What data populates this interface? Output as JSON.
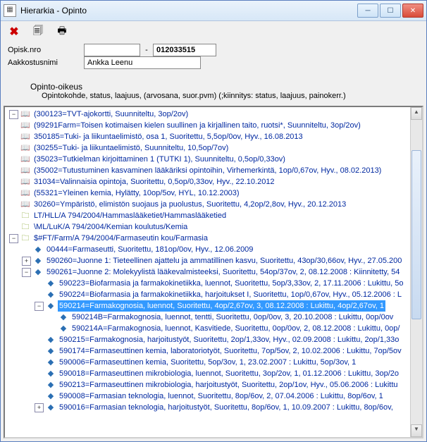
{
  "window": {
    "title": "Hierarkia - Opinto"
  },
  "form": {
    "label_opisknro": "Opisk.nro",
    "label_aakostusnimi": "Aakkostusnimi",
    "blank_field": "",
    "dash": "-",
    "student_id": "012033515",
    "student_name": "Ankka Leenu",
    "heading": "Opinto-oikeus",
    "subdesc": "Opintokohde, status, laajuus, (arvosana, suor.pvm) (;kiinnitys: status, laajuus, painokerr.)"
  },
  "tree": [
    {
      "depth": 0,
      "toggle": "-",
      "icon": "book",
      "text": "(300123=TVT-ajokortti, Suunniteltu, 3op/2ov)"
    },
    {
      "depth": 0,
      "toggle": "",
      "icon": "book",
      "text": "(99291Farm=Toisen kotimaisen kielen suullinen ja kirjallinen taito, ruotsi*, Suunniteltu, 3op/2ov)"
    },
    {
      "depth": 0,
      "toggle": "",
      "icon": "book",
      "text": "350185=Tuki- ja liikuntaelimistö, osa 1, Suoritettu, 5,5op/0ov, Hyv., 16.08.2013"
    },
    {
      "depth": 0,
      "toggle": "",
      "icon": "book",
      "text": "(30255=Tuki- ja liikuntaelimistö, Suunniteltu, 10,5op/7ov)"
    },
    {
      "depth": 0,
      "toggle": "",
      "icon": "book",
      "text": "(35023=Tutkielman kirjoittaminen 1 (TUTKI 1), Suunniteltu, 0,5op/0,33ov)"
    },
    {
      "depth": 0,
      "toggle": "",
      "icon": "book",
      "text": "(35002=Tutustuminen kasvaminen lääkäriksi opintoihin, Virhemerkintä, 1op/0,67ov, Hyv., 08.02.2013)"
    },
    {
      "depth": 0,
      "toggle": "",
      "icon": "book",
      "text": "31034=Valinnaisia opintoja, Suoritettu, 0,5op/0,33ov, Hyv., 22.10.2012"
    },
    {
      "depth": 0,
      "toggle": "",
      "icon": "book",
      "text": "(55321=Yleinen kemia, Hylätty, 10op/5ov, HYL, 10.12.2003)"
    },
    {
      "depth": 0,
      "toggle": "",
      "icon": "book",
      "text": "30260=Ympäristö, elimistön suojaus ja puolustus, Suoritettu, 4,2op/2,8ov, Hyv., 20.12.2013"
    },
    {
      "depth": 0,
      "toggle": "",
      "icon": "folder",
      "text": "LT/HLL/A 794/2004/Hammaslääketiet/Hammaslääketied"
    },
    {
      "depth": 0,
      "toggle": "",
      "icon": "folder",
      "text": "\\ML/LuK/A 794/2004/Kemian koulutus/Kemia"
    },
    {
      "depth": 0,
      "toggle": "-",
      "icon": "folder",
      "text": "$#FT/Farm/A 794/2004/Farmaseutin kou/Farmasia"
    },
    {
      "depth": 1,
      "toggle": "",
      "icon": "cube",
      "text": "00444=Farmaseutti, Suoritettu, 181op/0ov, Hyv., 12.06.2009"
    },
    {
      "depth": 1,
      "toggle": "+",
      "icon": "cube",
      "text": "590260=Juonne 1: Tieteellinen ajattelu ja ammatillinen kasvu, Suoritettu, 43op/30,66ov, Hyv., 27.05.200"
    },
    {
      "depth": 1,
      "toggle": "-",
      "icon": "cube",
      "text": "590261=Juonne 2: Molekyylistä lääkevalmisteeksi, Suoritettu, 54op/37ov, 2, 08.12.2008 : Kiinnitetty, 54"
    },
    {
      "depth": 2,
      "toggle": "",
      "icon": "cube",
      "text": "590223=Biofarmasia ja farmakokinetiikka, luennot, Suoritettu, 5op/3,33ov, 2, 17.11.2006 : Lukittu, 5o"
    },
    {
      "depth": 2,
      "toggle": "",
      "icon": "cube",
      "text": "590224=Biofarmasia ja farmakokinetiikka, harjoitukset I, Suoritettu, 1op/0,67ov, Hyv., 05.12.2006 : L"
    },
    {
      "depth": 2,
      "toggle": "-",
      "icon": "cube",
      "text": "590214=Farmakognosia, luennot, Suoritettu, 4op/2,67ov, 3, 08.12.2008 : Lukittu, 4op/2,67ov, 1",
      "selected": true
    },
    {
      "depth": 3,
      "toggle": "",
      "icon": "cube",
      "text": "590214B=Farmakognosia, luennot, tentti, Suoritettu, 0op/0ov, 3, 20.10.2008 : Lukittu, 0op/0ov"
    },
    {
      "depth": 3,
      "toggle": "",
      "icon": "cube",
      "text": "590214A=Farmakognosia, luennot, Kasvitiede, Suoritettu, 0op/0ov, 2, 08.12.2008 : Lukittu, 0op/"
    },
    {
      "depth": 2,
      "toggle": "",
      "icon": "cube",
      "text": "590215=Farmakognosia, harjoitustyöt, Suoritettu, 2op/1,33ov, Hyv., 02.09.2008 : Lukittu, 2op/1,33o"
    },
    {
      "depth": 2,
      "toggle": "",
      "icon": "cube",
      "text": "590174=Farmaseuttinen kemia, laboratoriotyöt, Suoritettu, 7op/5ov, 2, 10.02.2006 : Lukittu, 7op/5ov"
    },
    {
      "depth": 2,
      "toggle": "",
      "icon": "cube",
      "text": "590006=Farmaseuttinen kemia, Suoritettu, 5op/3ov, 1, 23.02.2007 : Lukittu, 5op/3ov, 1"
    },
    {
      "depth": 2,
      "toggle": "",
      "icon": "cube",
      "text": "590018=Farmaseuttinen mikrobiologia, luennot, Suoritettu, 3op/2ov, 1, 01.12.2006 : Lukittu, 3op/2o"
    },
    {
      "depth": 2,
      "toggle": "",
      "icon": "cube",
      "text": "590213=Farmaseuttinen mikrobiologia, harjoitustyöt, Suoritettu, 2op/1ov, Hyv., 05.06.2006 : Lukittu"
    },
    {
      "depth": 2,
      "toggle": "",
      "icon": "cube",
      "text": "590008=Farmasian teknologia, luennot, Suoritettu, 8op/6ov, 2, 07.04.2006 : Lukittu, 8op/6ov, 1"
    },
    {
      "depth": 2,
      "toggle": "+",
      "icon": "cube",
      "text": "590016=Farmasian teknologia, harjoitustyöt, Suoritettu, 8op/6ov, 1, 10.09.2007 : Lukittu, 8op/6ov,"
    }
  ],
  "icons": {
    "book": "📖",
    "folder": "🗀",
    "cube": "◆"
  }
}
